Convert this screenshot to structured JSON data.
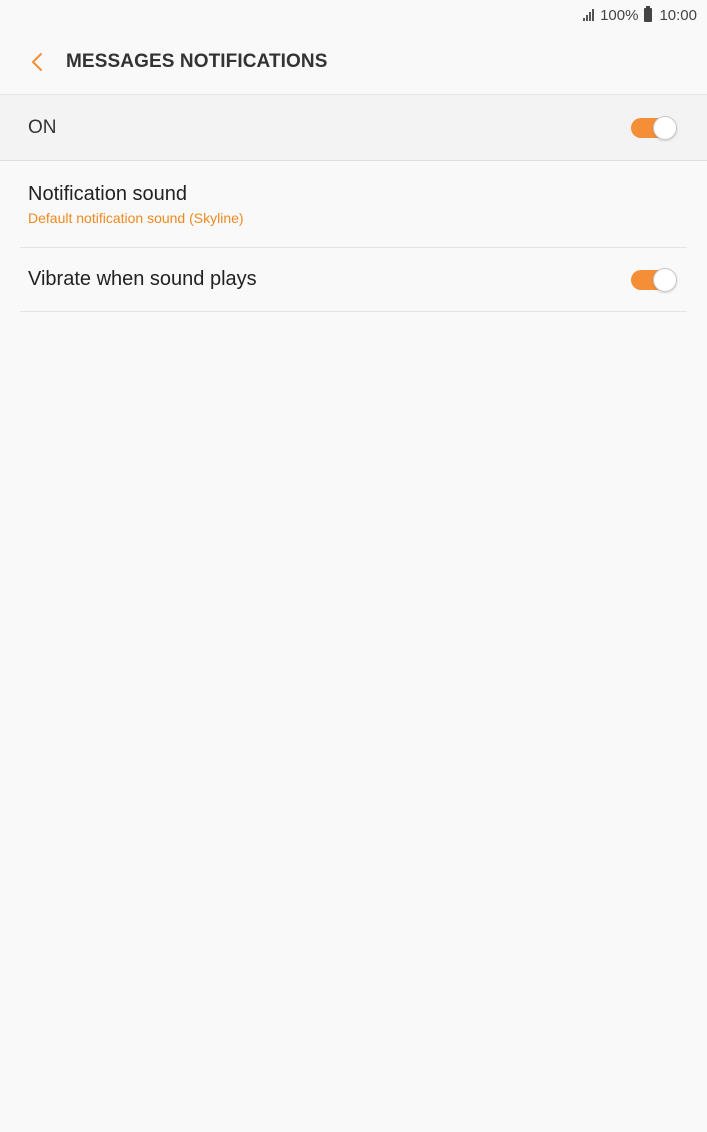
{
  "status_bar": {
    "battery_percent": "100%",
    "time": "10:00"
  },
  "header": {
    "title": "MESSAGES NOTIFICATIONS",
    "back_icon": "chevron-left-icon"
  },
  "master_switch": {
    "label": "ON",
    "checked": true
  },
  "settings": [
    {
      "title": "Notification sound",
      "subtitle": "Default notification sound (Skyline)"
    },
    {
      "title": "Vibrate when sound plays",
      "checked": true
    }
  ],
  "colors": {
    "accent": "#f48f37",
    "subtitle": "#f0891f",
    "background": "#f9f9f9"
  }
}
